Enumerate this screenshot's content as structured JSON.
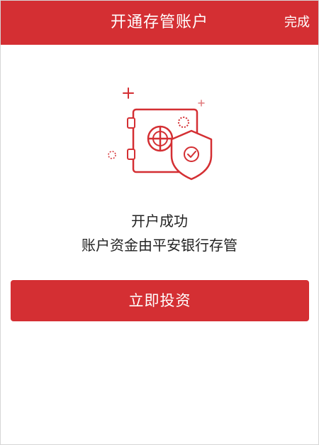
{
  "header": {
    "title": "开通存管账户",
    "done_label": "完成"
  },
  "result": {
    "line1": "开户成功",
    "line2": "账户资金由平安银行存管"
  },
  "action": {
    "invest_label": "立即投资"
  },
  "illustration": {
    "icon": "safe-with-shield-check-icon",
    "color": "#d42f33"
  },
  "colors": {
    "accent": "#d42f33"
  }
}
